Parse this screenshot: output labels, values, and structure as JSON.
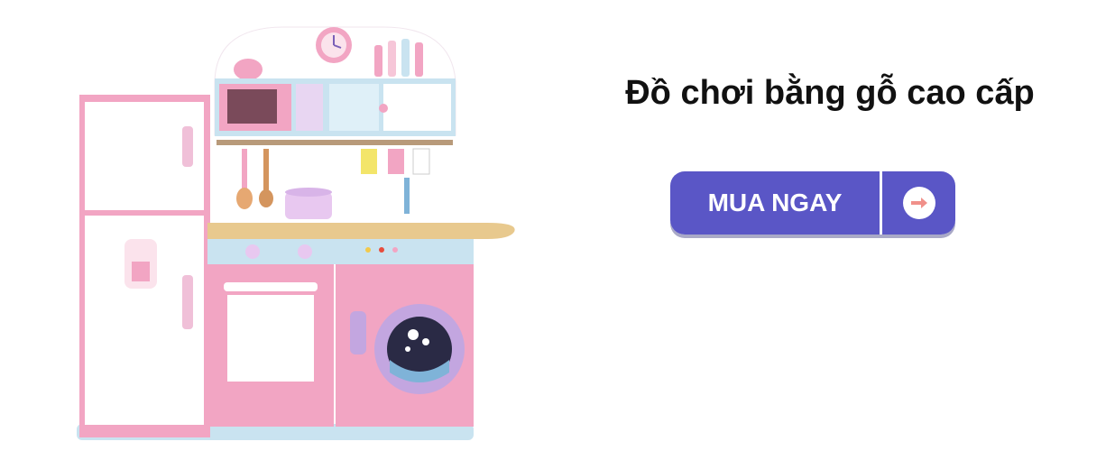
{
  "headline": "Đồ chơi bằng gỗ cao cấp",
  "cta": {
    "label": "MUA NGAY",
    "icon": "arrow-right-icon"
  },
  "product_image": {
    "subject": "toy-kitchen-icon"
  },
  "colors": {
    "button_bg": "#5a56c6",
    "button_text": "#ffffff",
    "arrow": "#f0908a",
    "toy_pink": "#f2a5c3",
    "toy_blue": "#c9e3f0",
    "toy_white": "#ffffff"
  }
}
